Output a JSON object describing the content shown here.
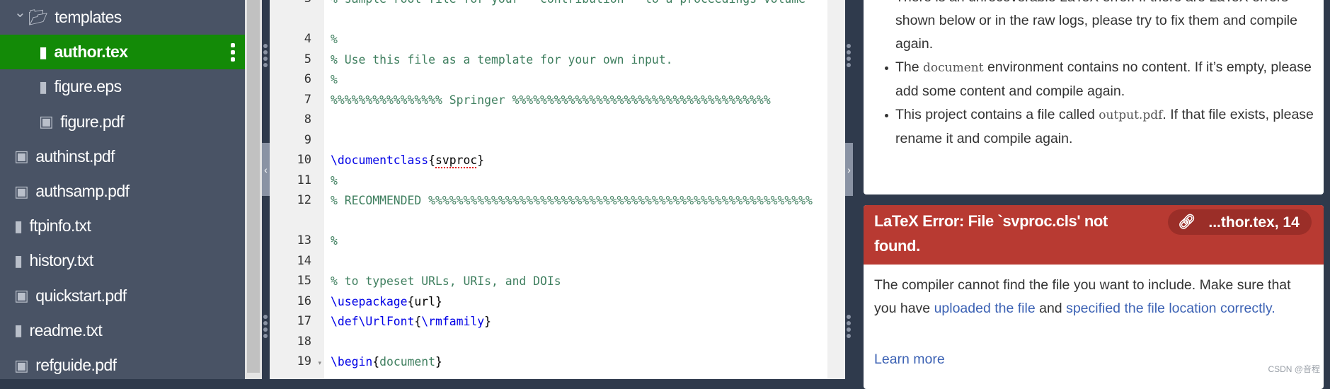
{
  "sidebar": {
    "items": [
      {
        "label": "templates",
        "icon": "folder-open-icon",
        "level": 0,
        "expanded": true
      },
      {
        "label": "author.tex",
        "icon": "file-icon",
        "level": 1,
        "selected": true
      },
      {
        "label": "figure.eps",
        "icon": "file-icon",
        "level": 1
      },
      {
        "label": "figure.pdf",
        "icon": "image-icon",
        "level": 1
      },
      {
        "label": "authinst.pdf",
        "icon": "image-icon",
        "level": 0
      },
      {
        "label": "authsamp.pdf",
        "icon": "image-icon",
        "level": 0
      },
      {
        "label": "ftpinfo.txt",
        "icon": "file-icon",
        "level": 0
      },
      {
        "label": "history.txt",
        "icon": "file-icon",
        "level": 0
      },
      {
        "label": "quickstart.pdf",
        "icon": "image-icon",
        "level": 0
      },
      {
        "label": "readme.txt",
        "icon": "file-icon",
        "level": 0
      },
      {
        "label": "refguide.pdf",
        "icon": "image-icon",
        "level": 0
      }
    ],
    "selected_color": "#138a07"
  },
  "editor": {
    "lines": [
      {
        "num": "3",
        "rows": 2,
        "tokens": [
          {
            "t": "comment",
            "v": "% sample root file for your ``contribution'' to a proceedings volume"
          }
        ]
      },
      {
        "num": "4",
        "tokens": [
          {
            "t": "comment",
            "v": "%"
          }
        ]
      },
      {
        "num": "5",
        "tokens": [
          {
            "t": "comment",
            "v": "% Use this file as a template for your own input."
          }
        ]
      },
      {
        "num": "6",
        "tokens": [
          {
            "t": "comment",
            "v": "%"
          }
        ]
      },
      {
        "num": "7",
        "tokens": [
          {
            "t": "comment",
            "v": "%%%%%%%%%%%%%%%% Springer %%%%%%%%%%%%%%%%%%%%%%%%%%%%%%%%%%%%%"
          }
        ]
      },
      {
        "num": "8",
        "tokens": []
      },
      {
        "num": "9",
        "tokens": []
      },
      {
        "num": "10",
        "tokens": [
          {
            "t": "kw",
            "v": "\\documentclass"
          },
          {
            "t": "plain",
            "v": "{"
          },
          {
            "t": "err",
            "v": "svproc"
          },
          {
            "t": "plain",
            "v": "}"
          }
        ]
      },
      {
        "num": "11",
        "tokens": [
          {
            "t": "comment",
            "v": "%"
          }
        ]
      },
      {
        "num": "12",
        "rows": 2,
        "tokens": [
          {
            "t": "comment",
            "v": "% RECOMMENDED %%%%%%%%%%%%%%%%%%%%%%%%%%%%%%%%%%%%%%%%%%%%%%%%%%%%%%%"
          }
        ]
      },
      {
        "num": "13",
        "tokens": [
          {
            "t": "comment",
            "v": "%"
          }
        ]
      },
      {
        "num": "14",
        "tokens": []
      },
      {
        "num": "15",
        "tokens": [
          {
            "t": "comment",
            "v": "% to typeset URLs, URIs, and DOIs"
          }
        ]
      },
      {
        "num": "16",
        "tokens": [
          {
            "t": "kw",
            "v": "\\usepackage"
          },
          {
            "t": "plain",
            "v": "{url}"
          }
        ]
      },
      {
        "num": "17",
        "tokens": [
          {
            "t": "kw",
            "v": "\\def\\UrlFont"
          },
          {
            "t": "plain",
            "v": "{"
          },
          {
            "t": "kw",
            "v": "\\rmfamily"
          },
          {
            "t": "plain",
            "v": "}"
          }
        ]
      },
      {
        "num": "18",
        "tokens": []
      },
      {
        "num": "19",
        "fold": true,
        "tokens": [
          {
            "t": "kw",
            "v": "\\begin"
          },
          {
            "t": "plain",
            "v": "{"
          },
          {
            "t": "arg",
            "v": "document"
          },
          {
            "t": "plain",
            "v": "}"
          }
        ]
      }
    ]
  },
  "logs": {
    "no_pdf": {
      "bullets": [
        [
          {
            "t": "text",
            "v": "There is an unrecoverable LaTeX error. If there are LaTeX errors shown below or in the raw logs, please try to fix them and compile again."
          }
        ],
        [
          {
            "t": "text",
            "v": "The "
          },
          {
            "t": "code",
            "v": "document"
          },
          {
            "t": "text",
            "v": " environment contains no content. If it’s empty, please add some content and compile again."
          }
        ],
        [
          {
            "t": "text",
            "v": "This project contains a file called "
          },
          {
            "t": "code",
            "v": "output.pdf"
          },
          {
            "t": "text",
            "v": ". If that file exists, please rename it and compile again."
          }
        ]
      ]
    },
    "error": {
      "title": "LaTeX Error: File `svproc.cls' not found.",
      "location": "...thor.tex, 14",
      "body_1": "The compiler cannot find the file you want to include. Make sure that you have ",
      "link_1": "uploaded the file",
      "body_2": " and ",
      "link_2": "specified the file location correctly",
      "body_3": ".",
      "learn_more": "Learn more",
      "header_color": "#b83a32"
    }
  },
  "watermark": "CSDN @音程"
}
